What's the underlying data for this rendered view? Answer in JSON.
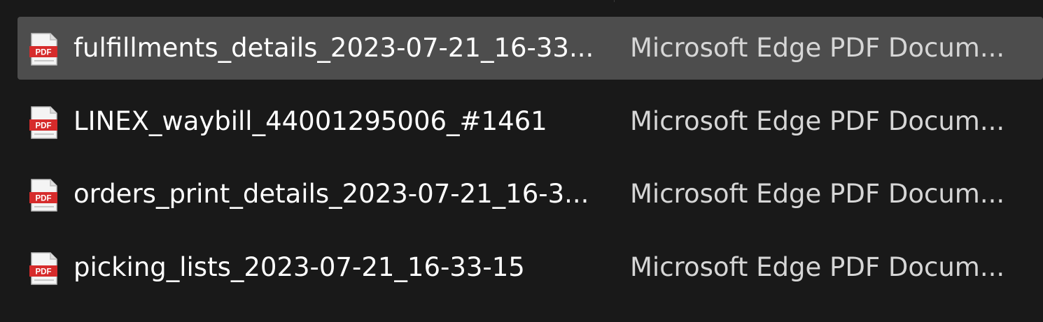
{
  "files": [
    {
      "name": "fulfillments_details_2023-07-21_16-33...",
      "type": "Microsoft Edge PDF Docum...",
      "icon": "pdf-file-icon",
      "icon_label": "PDF",
      "selected": true
    },
    {
      "name": "LINEX_waybill_44001295006_#1461",
      "type": "Microsoft Edge PDF Docum...",
      "icon": "pdf-file-icon",
      "icon_label": "PDF",
      "selected": false
    },
    {
      "name": "orders_print_details_2023-07-21_16-3...",
      "type": "Microsoft Edge PDF Docum...",
      "icon": "pdf-file-icon",
      "icon_label": "PDF",
      "selected": false
    },
    {
      "name": "picking_lists_2023-07-21_16-33-15",
      "type": "Microsoft Edge PDF Docum...",
      "icon": "pdf-file-icon",
      "icon_label": "PDF",
      "selected": false
    }
  ],
  "colors": {
    "background": "#191919",
    "selected_row": "#4d4d4d",
    "name_text": "#ffffff",
    "type_text": "#d6d6d6",
    "pdf_red": "#d62b2b"
  }
}
